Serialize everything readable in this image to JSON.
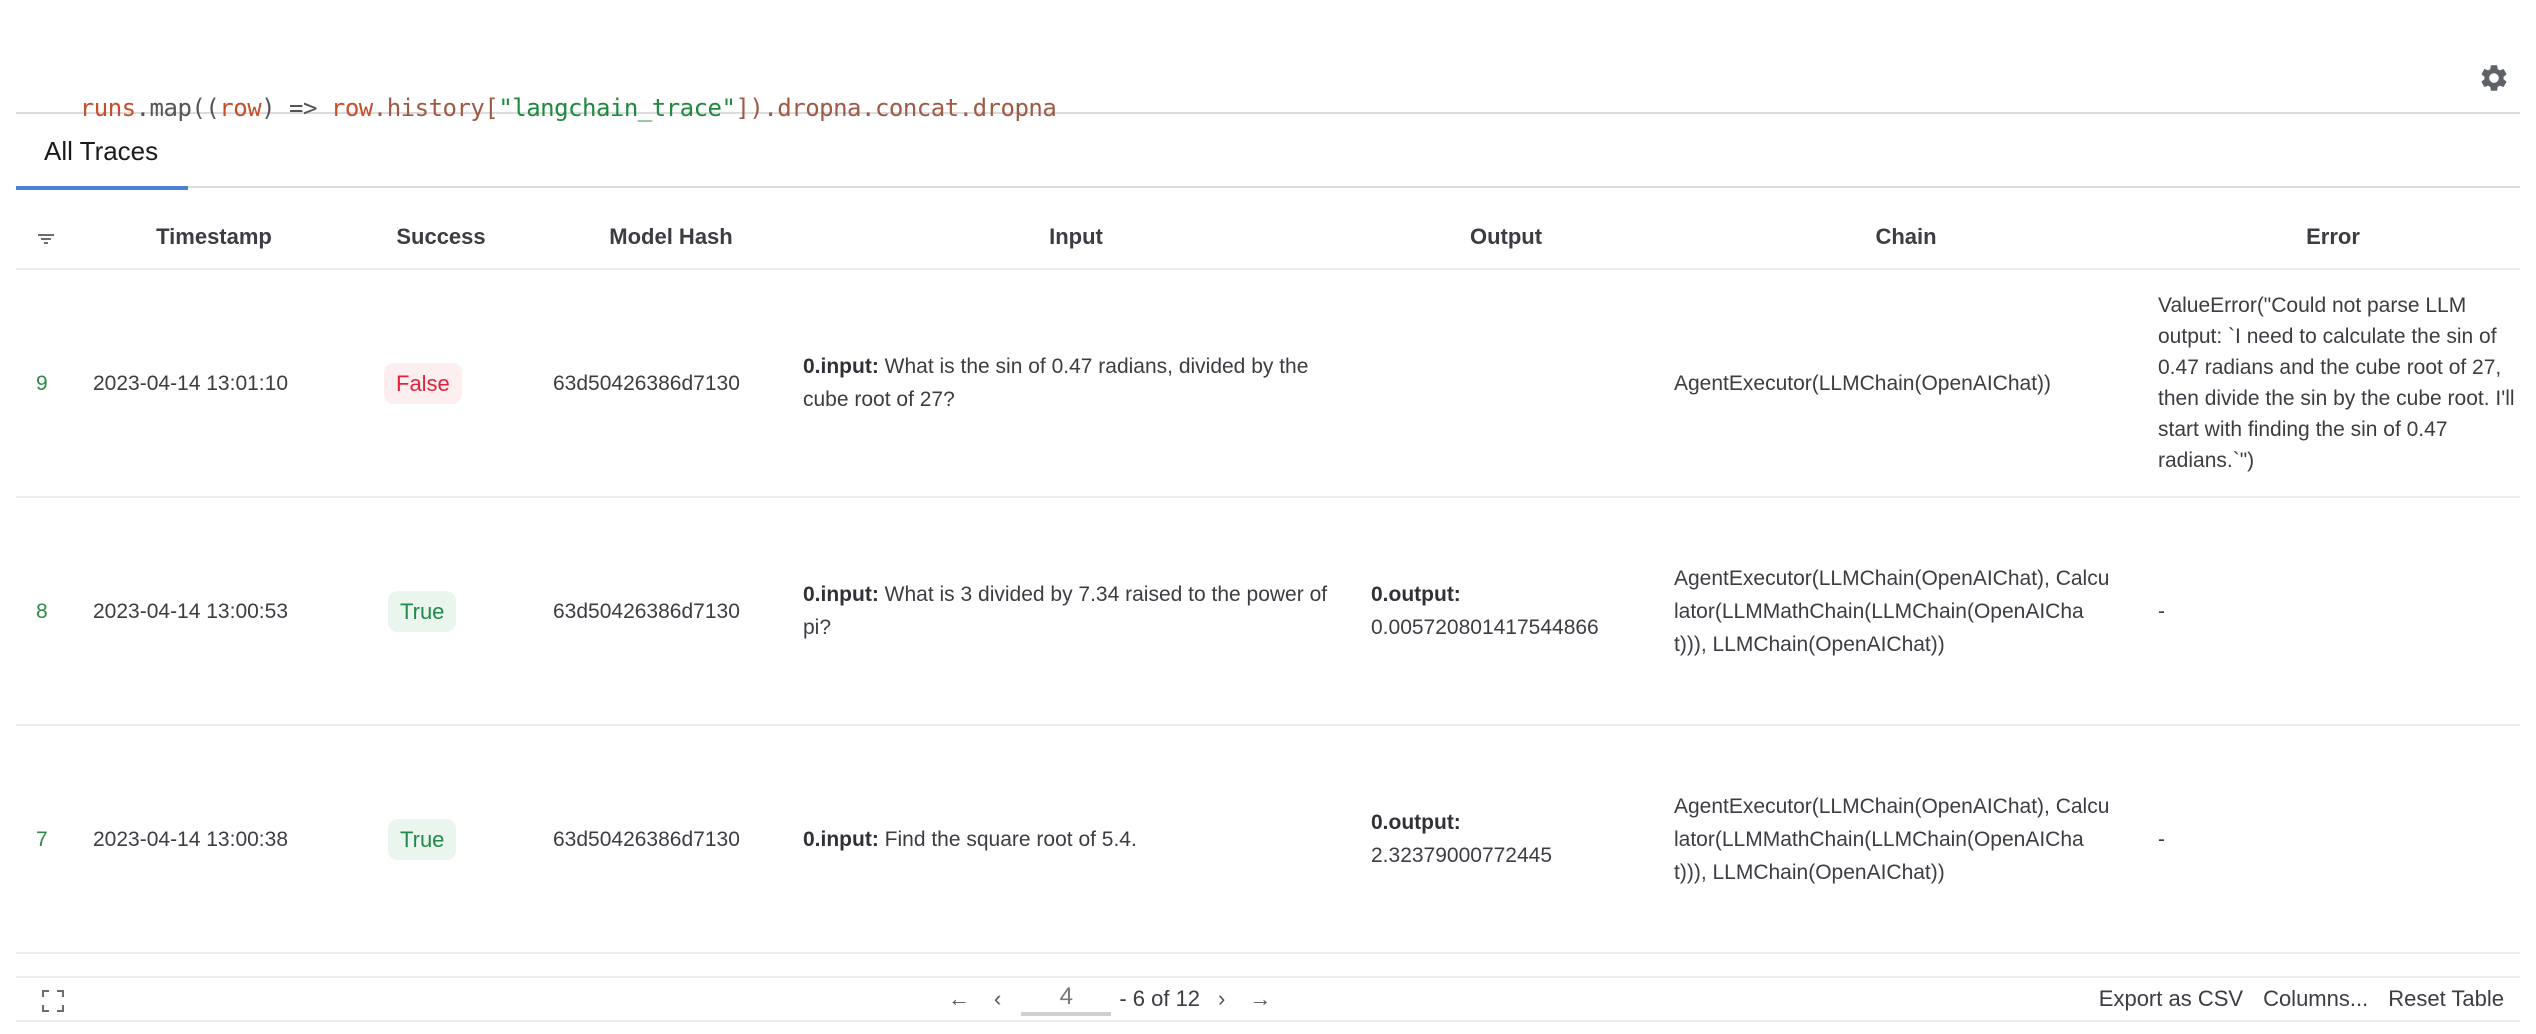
{
  "query": {
    "tokens": [
      {
        "text": "runs",
        "kind": "var"
      },
      {
        "text": ".map((",
        "kind": "punct"
      },
      {
        "text": "row",
        "kind": "var"
      },
      {
        "text": ") => ",
        "kind": "punct"
      },
      {
        "text": "row",
        "kind": "var"
      },
      {
        "text": ".history[",
        "kind": "meth"
      },
      {
        "text": "\"langchain_trace\"",
        "kind": "str"
      },
      {
        "text": "]).dropna.concat.dropna",
        "kind": "meth"
      }
    ],
    "settings_icon": "gear-icon"
  },
  "tabs": [
    {
      "label": "All Traces",
      "active": true
    }
  ],
  "table": {
    "filter_icon": "filter-icon",
    "columns": [
      "Timestamp",
      "Success",
      "Model Hash",
      "Input",
      "Output",
      "Chain",
      "Error"
    ],
    "rows": [
      {
        "index": "9",
        "timestamp": "2023-04-14 13:01:10",
        "success": "False",
        "model_hash": "63d50426386d7130",
        "input_key": "0.input:",
        "input_value": " What is the sin of 0.47 radians, divided by the cube root of 27?",
        "output_key": "",
        "output_value": "",
        "chain": "AgentExecutor(LLMChain(OpenAIChat))",
        "error": "ValueError(\"Could not parse LLM output: `I need to calculate the sin of 0.47 radians and the cube root of 27, then divide the sin by the cube root. I'll start with finding the sin of 0.47 radians.`\")"
      },
      {
        "index": "8",
        "timestamp": "2023-04-14 13:00:53",
        "success": "True",
        "model_hash": "63d50426386d7130",
        "input_key": "0.input:",
        "input_value": " What is 3 divided by 7.34 raised to the power of pi?",
        "output_key": "0.output:",
        "output_value": "0.005720801417544866",
        "chain": "AgentExecutor(LLMChain(OpenAIChat), Calculator(LLMMathChain(LLMChain(OpenAIChat))), LLMChain(OpenAIChat))",
        "error": "-"
      },
      {
        "index": "7",
        "timestamp": "2023-04-14 13:00:38",
        "success": "True",
        "model_hash": "63d50426386d7130",
        "input_key": "0.input:",
        "input_value": " Find the square root of 5.4.",
        "output_key": "0.output:",
        "output_value": "2.32379000772445",
        "chain": "AgentExecutor(LLMChain(OpenAIChat), Calculator(LLMMathChain(LLMChain(OpenAIChat))), LLMChain(OpenAIChat))",
        "error": "-"
      }
    ]
  },
  "footer": {
    "fullscreen_icon": "fullscreen-icon",
    "pager": {
      "first": "←",
      "prev": "‹",
      "page_start": "4",
      "range_text": "- 6 of 12",
      "next": "›",
      "last": "→"
    },
    "export_label": "Export as CSV",
    "columns_label": "Columns...",
    "reset_label": "Reset Table"
  }
}
